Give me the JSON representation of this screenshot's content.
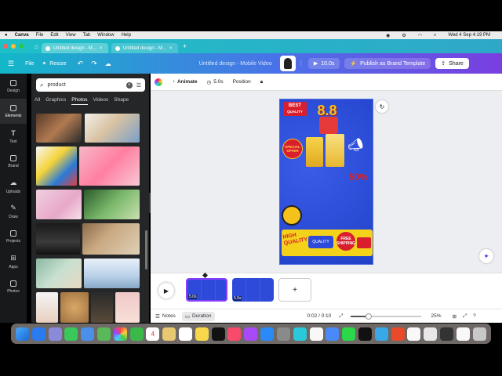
{
  "menubar": {
    "app": "Canva",
    "items": [
      "File",
      "Edit",
      "View",
      "Tab",
      "Window",
      "Help"
    ],
    "datetime": "Wed 4 Sep  4:19 PM"
  },
  "browser": {
    "tabs": [
      {
        "label": "Untitled design - M..."
      },
      {
        "label": "Untitled design - M..."
      }
    ],
    "new_tab": "+"
  },
  "topbar": {
    "file": "File",
    "resize": "Resize",
    "title": "Untitled design - Mobile Video",
    "duration": "10.0s",
    "publish": "Publish as Brand Template",
    "share": "Share"
  },
  "rail": {
    "items": [
      {
        "label": "Design",
        "icon": "layout-icon"
      },
      {
        "label": "Elements",
        "icon": "shapes-icon"
      },
      {
        "label": "Text",
        "icon": "text-icon"
      },
      {
        "label": "Brand",
        "icon": "crown-icon"
      },
      {
        "label": "Uploads",
        "icon": "cloud-upload-icon"
      },
      {
        "label": "Draw",
        "icon": "pen-icon"
      },
      {
        "label": "Projects",
        "icon": "folder-icon"
      },
      {
        "label": "Apps",
        "icon": "grid-icon"
      },
      {
        "label": "Photos",
        "icon": "photo-icon"
      }
    ]
  },
  "panel": {
    "search_value": "product",
    "tabs": [
      "All",
      "Graphics",
      "Photos",
      "Videos",
      "Shape"
    ],
    "selected_tab": "Photos"
  },
  "canvas_toolbar": {
    "animate": "Animate",
    "duration": "5.0s",
    "position": "Position"
  },
  "design": {
    "badge_top": "BEST",
    "badge_bottom": "QUALITY",
    "big_number": "8.8",
    "special": "SPECIAL OFFER",
    "percent": "50%",
    "high": "HIGH",
    "quality": "QUALITY",
    "free": "FREE",
    "shipping": "SHIPPING",
    "quality_small": "QUALITY"
  },
  "timeline": {
    "clip1_time": "5.0s",
    "clip2_time": "5.0s",
    "add": "+"
  },
  "bottombar": {
    "notes": "Notes",
    "duration": "Duration",
    "time": "0:02 / 0:10",
    "zoom": "25%",
    "zoom_level": 0.25
  },
  "colors": {
    "accent": "#8b3dff",
    "canvas_bg": "#2d4bd8",
    "badge_red": "#d91e2e",
    "gold": "#f4c21a"
  }
}
